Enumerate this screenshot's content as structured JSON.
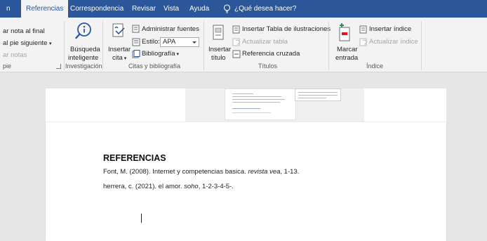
{
  "tabs": [
    {
      "label": "n"
    },
    {
      "label": "Referencias"
    },
    {
      "label": "Correspondencia"
    },
    {
      "label": "Revisar"
    },
    {
      "label": "Vista"
    },
    {
      "label": "Ayuda"
    }
  ],
  "tell_me": "¿Qué desea hacer?",
  "ribbon": {
    "footnotes": {
      "insert_endnote": "ar nota al final",
      "next_footnote": "al pie siguiente",
      "show_notes": "ar notas",
      "group_label": "pie"
    },
    "research": {
      "smart_lookup_line1": "Búsqueda",
      "smart_lookup_line2": "inteligente",
      "group_label": "Investigación"
    },
    "citations": {
      "insert_citation_line1": "Insertar",
      "insert_citation_line2": "cita",
      "manage_sources": "Administrar fuentes",
      "style_label": "Estilo:",
      "style_value": "APA",
      "bibliography": "Bibliografía",
      "group_label": "Citas y bibliografía"
    },
    "captions": {
      "insert_caption_line1": "Insertar",
      "insert_caption_line2": "título",
      "insert_table_of_figures": "Insertar Tabla de ilustraciones",
      "update_table": "Actualizar tabla",
      "cross_reference": "Referencia cruzada",
      "group_label": "Títulos"
    },
    "index": {
      "mark_entry_line1": "Marcar",
      "mark_entry_line2": "entrada",
      "insert_index": "Insertar índice",
      "update_index": "Actualizar índice",
      "group_label": "Índice"
    }
  },
  "document": {
    "heading": "REFERENCIAS",
    "references": [
      {
        "text": "Font, M. (2008). Internet y competencias basica. ",
        "italic": "revista vea",
        "tail": ", 1-13."
      },
      {
        "text": "herrera, c. (2021). el amor. ",
        "italic": "soho",
        "tail": ", 1-2-3-4-5-."
      }
    ]
  }
}
